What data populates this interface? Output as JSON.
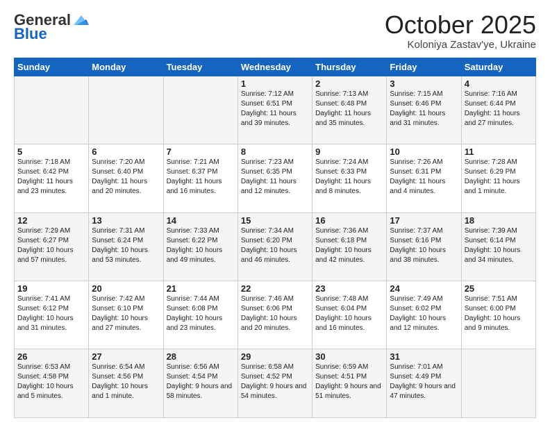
{
  "header": {
    "logo_general": "General",
    "logo_blue": "Blue",
    "month_title": "October 2025",
    "subtitle": "Koloniya Zastav'ye, Ukraine"
  },
  "weekdays": [
    "Sunday",
    "Monday",
    "Tuesday",
    "Wednesday",
    "Thursday",
    "Friday",
    "Saturday"
  ],
  "weeks": [
    [
      {
        "day": "",
        "info": ""
      },
      {
        "day": "",
        "info": ""
      },
      {
        "day": "",
        "info": ""
      },
      {
        "day": "1",
        "info": "Sunrise: 7:12 AM\nSunset: 6:51 PM\nDaylight: 11 hours and 39 minutes."
      },
      {
        "day": "2",
        "info": "Sunrise: 7:13 AM\nSunset: 6:48 PM\nDaylight: 11 hours and 35 minutes."
      },
      {
        "day": "3",
        "info": "Sunrise: 7:15 AM\nSunset: 6:46 PM\nDaylight: 11 hours and 31 minutes."
      },
      {
        "day": "4",
        "info": "Sunrise: 7:16 AM\nSunset: 6:44 PM\nDaylight: 11 hours and 27 minutes."
      }
    ],
    [
      {
        "day": "5",
        "info": "Sunrise: 7:18 AM\nSunset: 6:42 PM\nDaylight: 11 hours and 23 minutes."
      },
      {
        "day": "6",
        "info": "Sunrise: 7:20 AM\nSunset: 6:40 PM\nDaylight: 11 hours and 20 minutes."
      },
      {
        "day": "7",
        "info": "Sunrise: 7:21 AM\nSunset: 6:37 PM\nDaylight: 11 hours and 16 minutes."
      },
      {
        "day": "8",
        "info": "Sunrise: 7:23 AM\nSunset: 6:35 PM\nDaylight: 11 hours and 12 minutes."
      },
      {
        "day": "9",
        "info": "Sunrise: 7:24 AM\nSunset: 6:33 PM\nDaylight: 11 hours and 8 minutes."
      },
      {
        "day": "10",
        "info": "Sunrise: 7:26 AM\nSunset: 6:31 PM\nDaylight: 11 hours and 4 minutes."
      },
      {
        "day": "11",
        "info": "Sunrise: 7:28 AM\nSunset: 6:29 PM\nDaylight: 11 hours and 1 minute."
      }
    ],
    [
      {
        "day": "12",
        "info": "Sunrise: 7:29 AM\nSunset: 6:27 PM\nDaylight: 10 hours and 57 minutes."
      },
      {
        "day": "13",
        "info": "Sunrise: 7:31 AM\nSunset: 6:24 PM\nDaylight: 10 hours and 53 minutes."
      },
      {
        "day": "14",
        "info": "Sunrise: 7:33 AM\nSunset: 6:22 PM\nDaylight: 10 hours and 49 minutes."
      },
      {
        "day": "15",
        "info": "Sunrise: 7:34 AM\nSunset: 6:20 PM\nDaylight: 10 hours and 46 minutes."
      },
      {
        "day": "16",
        "info": "Sunrise: 7:36 AM\nSunset: 6:18 PM\nDaylight: 10 hours and 42 minutes."
      },
      {
        "day": "17",
        "info": "Sunrise: 7:37 AM\nSunset: 6:16 PM\nDaylight: 10 hours and 38 minutes."
      },
      {
        "day": "18",
        "info": "Sunrise: 7:39 AM\nSunset: 6:14 PM\nDaylight: 10 hours and 34 minutes."
      }
    ],
    [
      {
        "day": "19",
        "info": "Sunrise: 7:41 AM\nSunset: 6:12 PM\nDaylight: 10 hours and 31 minutes."
      },
      {
        "day": "20",
        "info": "Sunrise: 7:42 AM\nSunset: 6:10 PM\nDaylight: 10 hours and 27 minutes."
      },
      {
        "day": "21",
        "info": "Sunrise: 7:44 AM\nSunset: 6:08 PM\nDaylight: 10 hours and 23 minutes."
      },
      {
        "day": "22",
        "info": "Sunrise: 7:46 AM\nSunset: 6:06 PM\nDaylight: 10 hours and 20 minutes."
      },
      {
        "day": "23",
        "info": "Sunrise: 7:48 AM\nSunset: 6:04 PM\nDaylight: 10 hours and 16 minutes."
      },
      {
        "day": "24",
        "info": "Sunrise: 7:49 AM\nSunset: 6:02 PM\nDaylight: 10 hours and 12 minutes."
      },
      {
        "day": "25",
        "info": "Sunrise: 7:51 AM\nSunset: 6:00 PM\nDaylight: 10 hours and 9 minutes."
      }
    ],
    [
      {
        "day": "26",
        "info": "Sunrise: 6:53 AM\nSunset: 4:58 PM\nDaylight: 10 hours and 5 minutes."
      },
      {
        "day": "27",
        "info": "Sunrise: 6:54 AM\nSunset: 4:56 PM\nDaylight: 10 hours and 1 minute."
      },
      {
        "day": "28",
        "info": "Sunrise: 6:56 AM\nSunset: 4:54 PM\nDaylight: 9 hours and 58 minutes."
      },
      {
        "day": "29",
        "info": "Sunrise: 6:58 AM\nSunset: 4:52 PM\nDaylight: 9 hours and 54 minutes."
      },
      {
        "day": "30",
        "info": "Sunrise: 6:59 AM\nSunset: 4:51 PM\nDaylight: 9 hours and 51 minutes."
      },
      {
        "day": "31",
        "info": "Sunrise: 7:01 AM\nSunset: 4:49 PM\nDaylight: 9 hours and 47 minutes."
      },
      {
        "day": "",
        "info": ""
      }
    ]
  ]
}
